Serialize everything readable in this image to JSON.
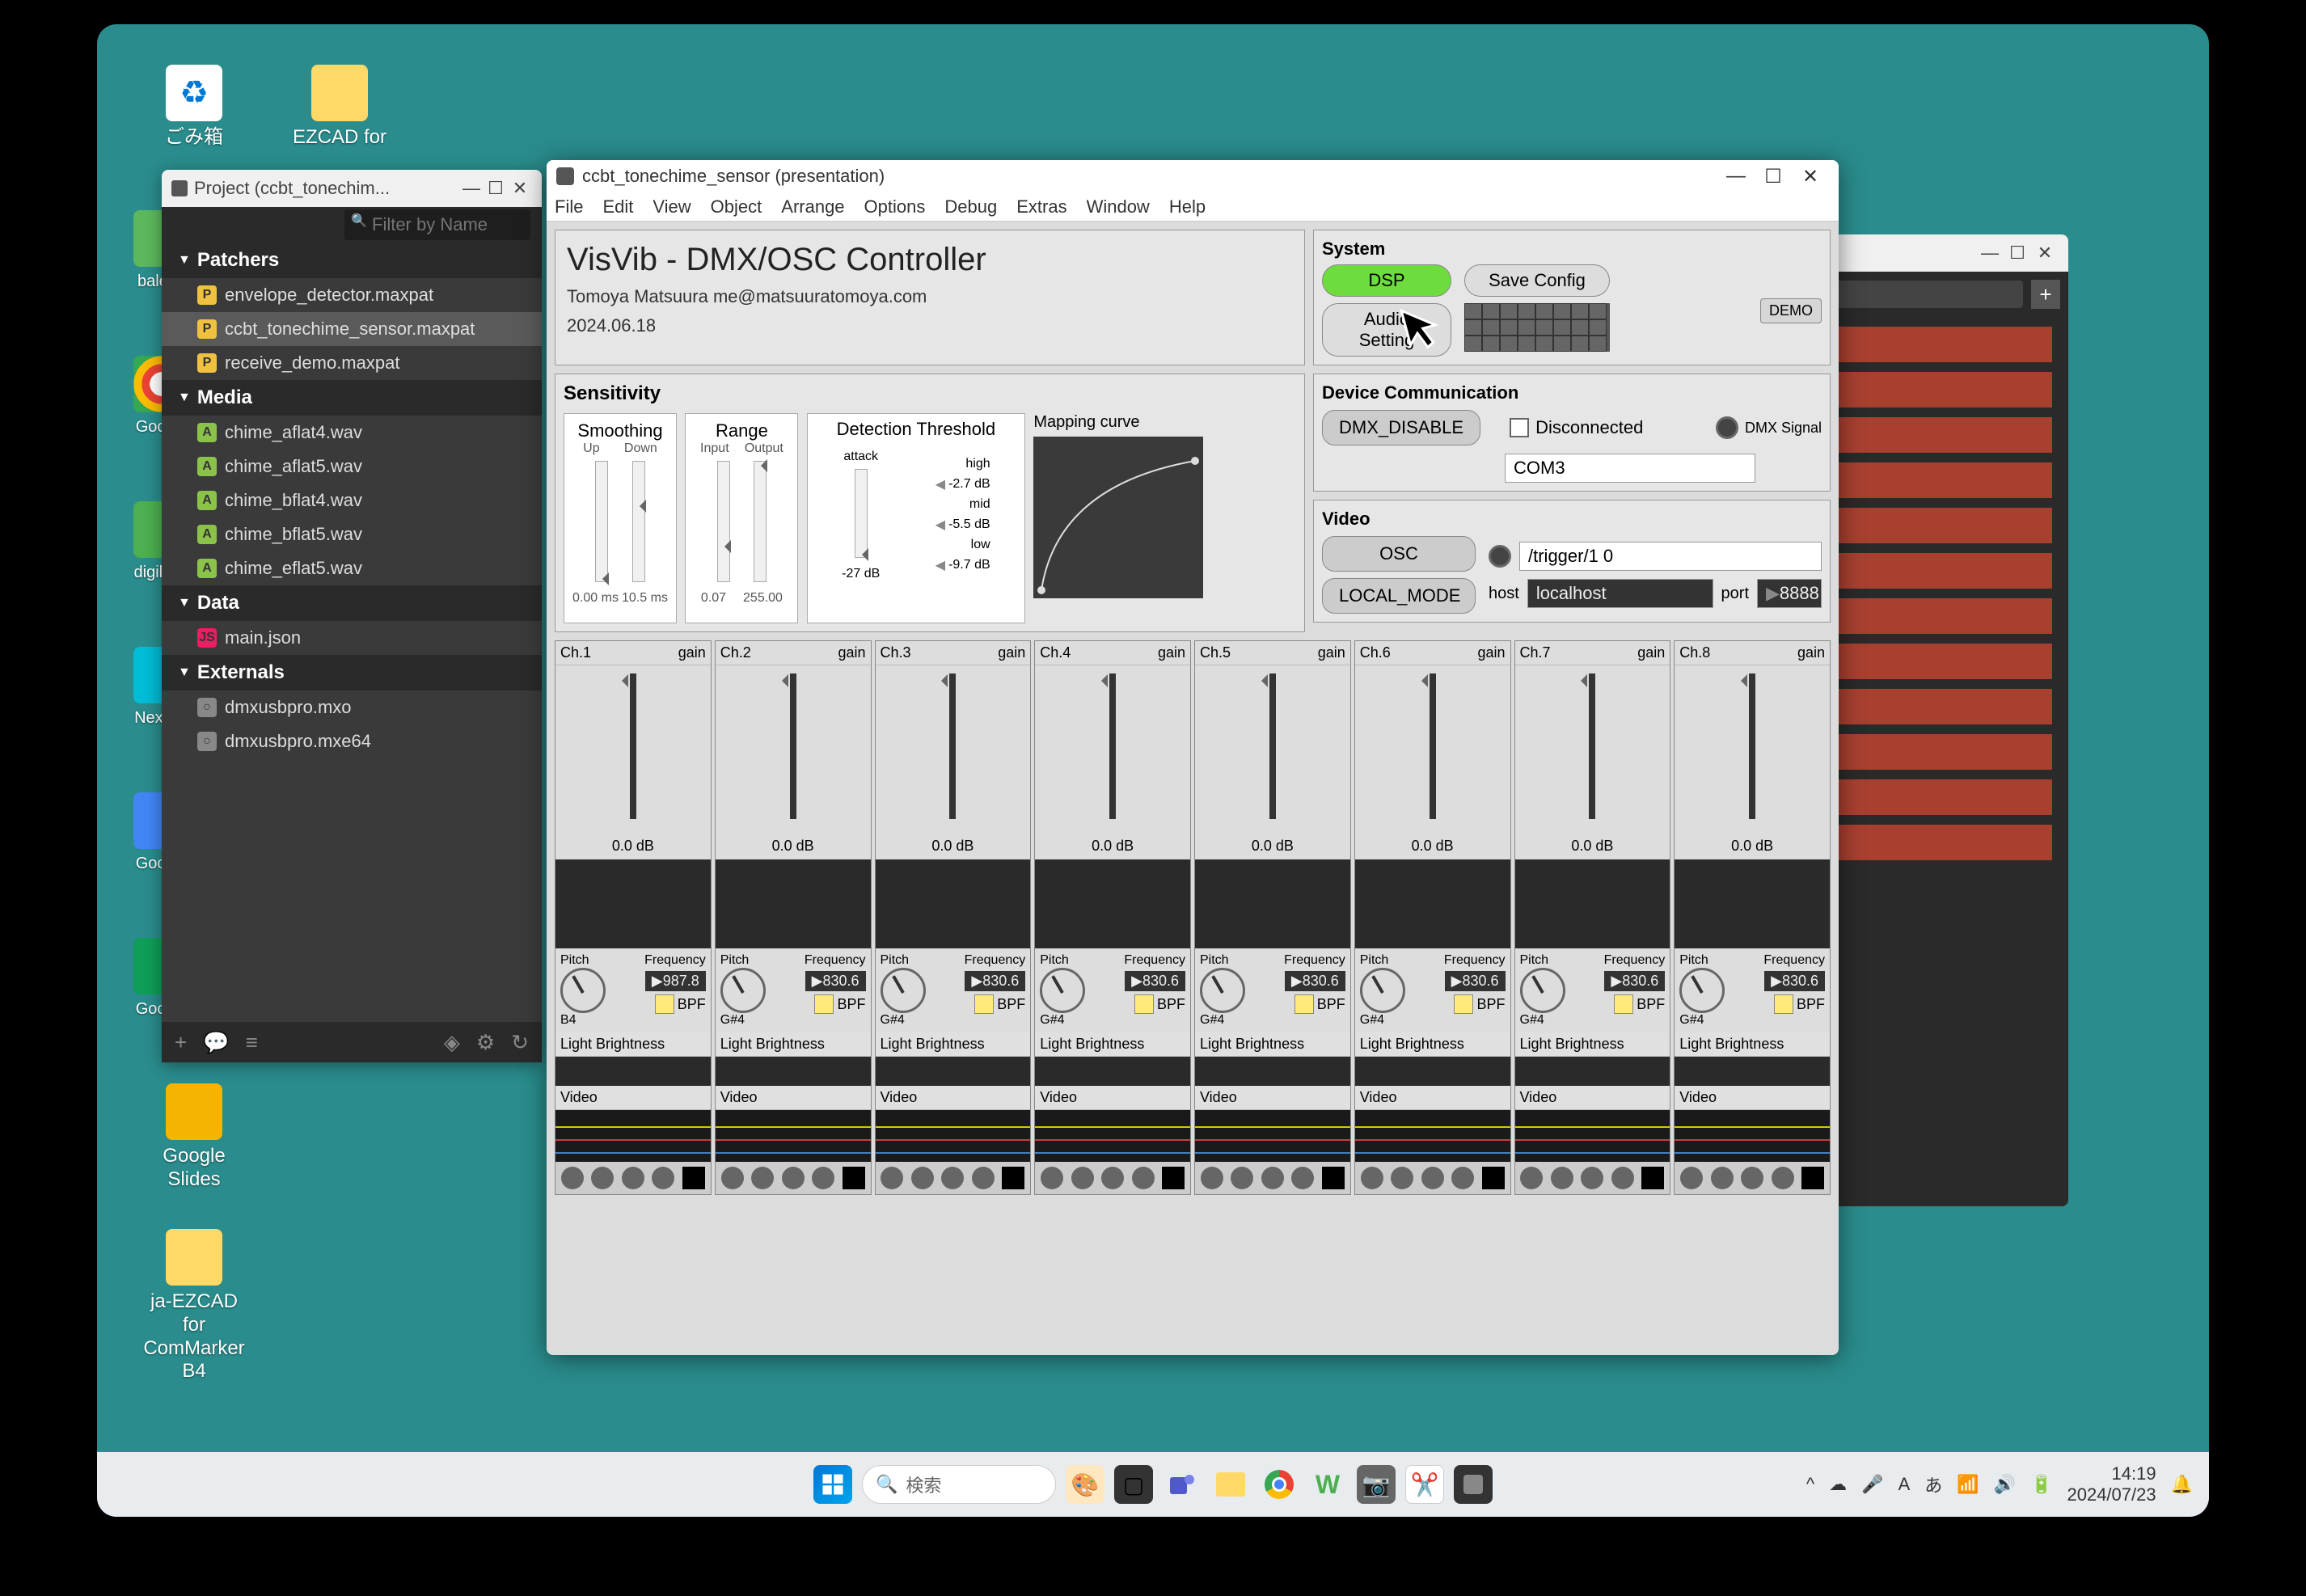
{
  "desktop": {
    "recycle": "ごみ箱",
    "ezcad": "EZCAD for",
    "balena": "balena",
    "google": "Google",
    "digilent": "digilent.",
    "nextion": "Nextion",
    "google2": "Google",
    "google3": "Google",
    "slides": "Google Slides",
    "ja_ezcad": "ja-EZCAD for ComMarker B4"
  },
  "project_panel": {
    "title": "Project (ccbt_tonechim...",
    "filter_placeholder": "Filter by Name",
    "sections": {
      "patchers": "Patchers",
      "media": "Media",
      "data": "Data",
      "externals": "Externals"
    },
    "patchers": [
      "envelope_detector.maxpat",
      "ccbt_tonechime_sensor.maxpat",
      "receive_demo.maxpat"
    ],
    "media": [
      "chime_aflat4.wav",
      "chime_aflat5.wav",
      "chime_bflat4.wav",
      "chime_bflat5.wav",
      "chime_eflat5.wav"
    ],
    "data": [
      "main.json"
    ],
    "externals": [
      "dmxusbpro.mxo",
      "dmxusbpro.mxe64"
    ]
  },
  "max": {
    "title": "ccbt_tonechime_sensor (presentation)",
    "menu": [
      "File",
      "Edit",
      "View",
      "Object",
      "Arrange",
      "Options",
      "Debug",
      "Extras",
      "Window",
      "Help"
    ],
    "header": {
      "title": "VisVib - DMX/OSC Controller",
      "author": "Tomoya Matsuura me@matsuuratomoya.com",
      "date": "2024.06.18"
    },
    "system": {
      "title": "System",
      "dsp": "DSP",
      "audio_setting": "Audio Setting",
      "save_config": "Save Config",
      "demo": "DEMO"
    },
    "sensitivity": {
      "title": "Sensitivity",
      "smoothing": {
        "label": "Smoothing",
        "up": "Up",
        "down": "Down",
        "left_val": "0.00 ms",
        "right_val": "10.5 ms"
      },
      "range": {
        "label": "Range",
        "input": "Input",
        "output": "Output",
        "left_val": "0.07",
        "right_val": "255.00"
      },
      "detection": {
        "label": "Detection Threshold",
        "attack": "attack",
        "high": "high",
        "mid": "mid",
        "low": "low",
        "db1": "-2.7 dB",
        "db2": "-5.5 dB",
        "db3": "-9.7 dB",
        "val": "-27 dB"
      },
      "mapping": "Mapping curve"
    },
    "devcom": {
      "title": "Device Communication",
      "dmx_disable": "DMX_DISABLE",
      "disconnected": "Disconnected",
      "dmx_signal": "DMX Signal",
      "com_port": "COM3"
    },
    "video": {
      "title": "Video",
      "osc": "OSC",
      "local_mode": "LOCAL_MODE",
      "trigger": "/trigger/1 0",
      "host_label": "host",
      "host": "localhost",
      "port_label": "port",
      "port": "8888"
    },
    "channels": [
      {
        "name": "Ch.1",
        "gain_label": "gain",
        "gain": "0.0 dB",
        "pitch_label": "Pitch",
        "freq_label": "Frequency",
        "freq": "987.8",
        "note": "B4",
        "bpf": "BPF",
        "light": "Light Brightness",
        "video": "Video"
      },
      {
        "name": "Ch.2",
        "gain_label": "gain",
        "gain": "0.0 dB",
        "pitch_label": "Pitch",
        "freq_label": "Frequency",
        "freq": "830.6",
        "note": "G#4",
        "bpf": "BPF",
        "light": "Light Brightness",
        "video": "Video"
      },
      {
        "name": "Ch.3",
        "gain_label": "gain",
        "gain": "0.0 dB",
        "pitch_label": "Pitch",
        "freq_label": "Frequency",
        "freq": "830.6",
        "note": "G#4",
        "bpf": "BPF",
        "light": "Light Brightness",
        "video": "Video"
      },
      {
        "name": "Ch.4",
        "gain_label": "gain",
        "gain": "0.0 dB",
        "pitch_label": "Pitch",
        "freq_label": "Frequency",
        "freq": "830.6",
        "note": "G#4",
        "bpf": "BPF",
        "light": "Light Brightness",
        "video": "Video"
      },
      {
        "name": "Ch.5",
        "gain_label": "gain",
        "gain": "0.0 dB",
        "pitch_label": "Pitch",
        "freq_label": "Frequency",
        "freq": "830.6",
        "note": "G#4",
        "bpf": "BPF",
        "light": "Light Brightness",
        "video": "Video"
      },
      {
        "name": "Ch.6",
        "gain_label": "gain",
        "gain": "0.0 dB",
        "pitch_label": "Pitch",
        "freq_label": "Frequency",
        "freq": "830.6",
        "note": "G#4",
        "bpf": "BPF",
        "light": "Light Brightness",
        "video": "Video"
      },
      {
        "name": "Ch.7",
        "gain_label": "gain",
        "gain": "0.0 dB",
        "pitch_label": "Pitch",
        "freq_label": "Frequency",
        "freq": "830.6",
        "note": "G#4",
        "bpf": "BPF",
        "light": "Light Brightness",
        "video": "Video"
      },
      {
        "name": "Ch.8",
        "gain_label": "gain",
        "gain": "0.0 dB",
        "pitch_label": "Pitch",
        "freq_label": "Frequency",
        "freq": "830.6",
        "note": "G#4",
        "bpf": "BPF",
        "light": "Light Brightness",
        "video": "Video"
      }
    ]
  },
  "taskbar": {
    "search_placeholder": "検索",
    "time": "14:19",
    "date": "2024/07/23"
  }
}
